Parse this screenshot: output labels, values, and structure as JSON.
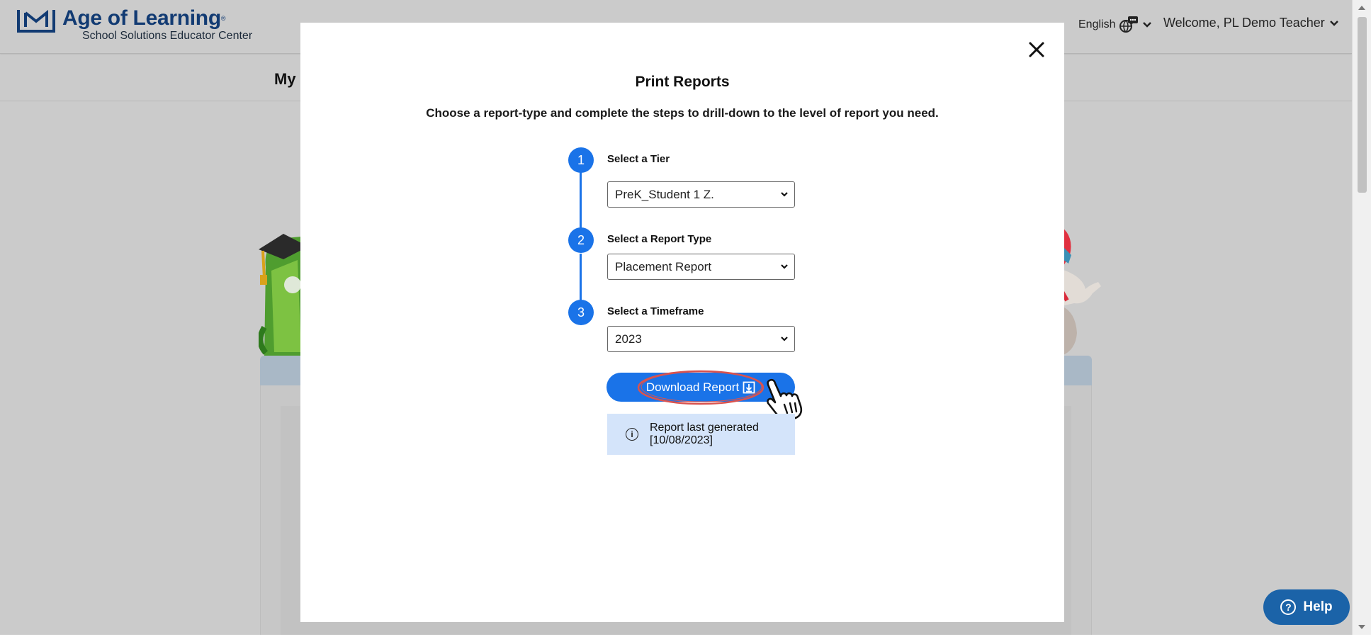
{
  "header": {
    "logo_title": "Age of Learning",
    "logo_mark": "®",
    "logo_subtitle": "School Solutions Educator Center",
    "language": "English",
    "welcome": "Welcome, PL Demo Teacher"
  },
  "subnav": {
    "title": "My"
  },
  "modal": {
    "title": "Print Reports",
    "description": "Choose a report-type and complete the steps to drill-down to the level of report you need.",
    "steps": [
      {
        "number": "1",
        "label": "Select a Tier",
        "value": "PreK_Student 1 Z."
      },
      {
        "number": "2",
        "label": "Select a Report Type",
        "value": "Placement Report"
      },
      {
        "number": "3",
        "label": "Select a Timeframe",
        "value": "2023"
      }
    ],
    "download_label": "Download Report",
    "info_text": "Report last generated [10/08/2023]"
  },
  "help": {
    "label": "Help"
  },
  "colors": {
    "accent": "#1a73e8",
    "help": "#1b63a8",
    "annotation": "#d9534f",
    "info_bg": "#d4e4fa",
    "overlay_bg": "#cbcbcb"
  },
  "icons": {
    "close": "close-icon",
    "language": "globe-chat-icon",
    "chevron": "chevron-down-icon",
    "download": "download-icon",
    "info": "info-icon",
    "help": "question-icon",
    "cursor": "hand-pointer-icon"
  }
}
